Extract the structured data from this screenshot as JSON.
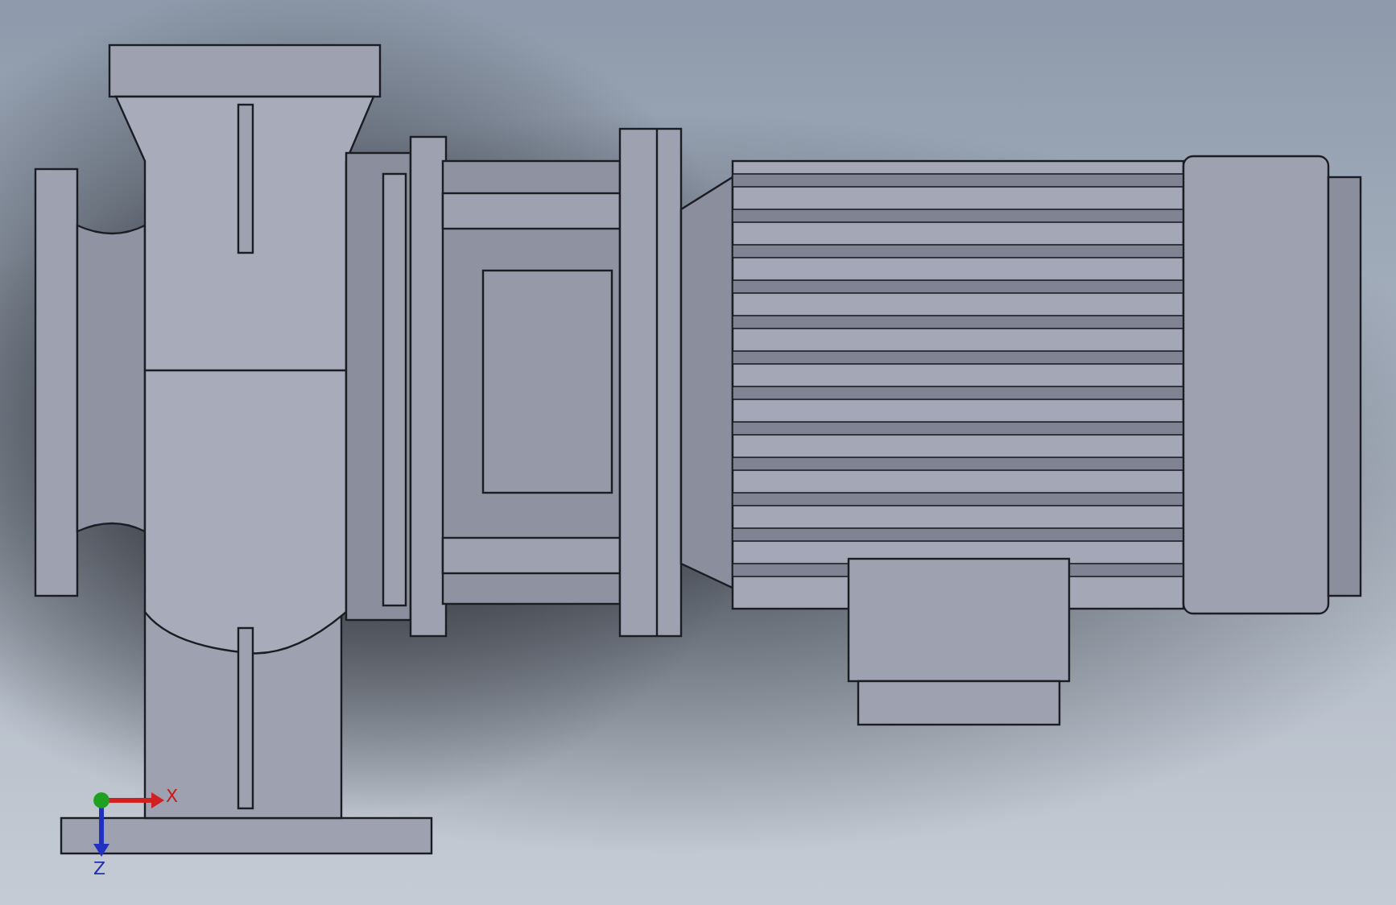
{
  "viewport": {
    "axes": [
      {
        "kind": "x",
        "label": "X"
      },
      {
        "kind": "z",
        "label": "Z"
      }
    ]
  }
}
